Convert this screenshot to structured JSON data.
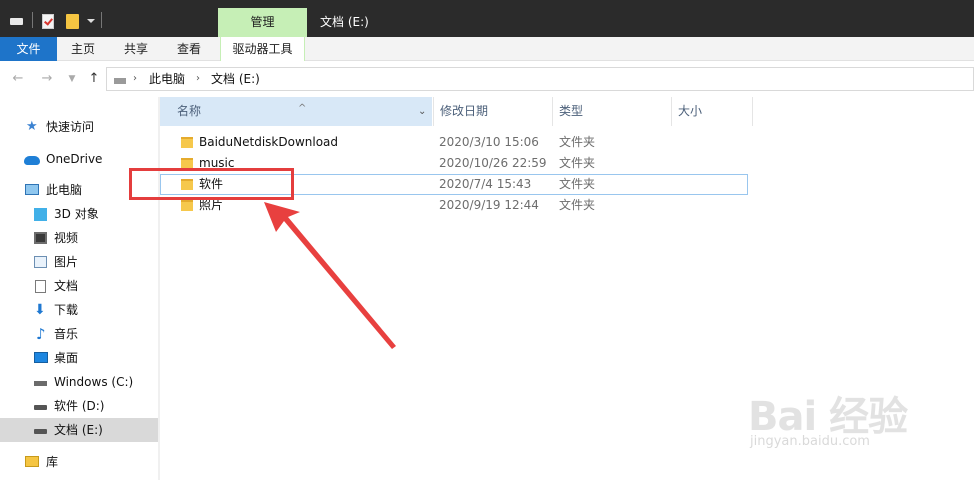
{
  "titlebar": {
    "manage_tab": "管理",
    "window_title": "文档 (E:)"
  },
  "ribbon": {
    "tabs": [
      "文件",
      "主页",
      "共享",
      "查看",
      "驱动器工具"
    ]
  },
  "address": {
    "segments": [
      "此电脑",
      "文档 (E:)"
    ]
  },
  "sidebar": {
    "items": [
      {
        "label": "快速访问",
        "icon": "star-icon"
      },
      {
        "label": "OneDrive",
        "icon": "cloud-icon"
      },
      {
        "label": "此电脑",
        "icon": "computer-icon"
      },
      {
        "label": "3D 对象",
        "icon": "cube-icon"
      },
      {
        "label": "视频",
        "icon": "video-icon"
      },
      {
        "label": "图片",
        "icon": "picture-icon"
      },
      {
        "label": "文档",
        "icon": "document-icon"
      },
      {
        "label": "下载",
        "icon": "download-icon"
      },
      {
        "label": "音乐",
        "icon": "music-icon"
      },
      {
        "label": "桌面",
        "icon": "desktop-icon"
      },
      {
        "label": "Windows (C:)",
        "icon": "windows-drive-icon"
      },
      {
        "label": "软件 (D:)",
        "icon": "drive-icon"
      },
      {
        "label": "文档 (E:)",
        "icon": "drive-icon",
        "selected": true
      },
      {
        "label": "库",
        "icon": "library-icon"
      }
    ]
  },
  "columns": {
    "name": "名称",
    "date": "修改日期",
    "type": "类型",
    "size": "大小"
  },
  "files": [
    {
      "name": "BaiduNetdiskDownload",
      "date": "2020/3/10 15:06",
      "type": "文件夹"
    },
    {
      "name": "music",
      "date": "2020/10/26 22:59",
      "type": "文件夹"
    },
    {
      "name": "软件",
      "date": "2020/7/4 15:43",
      "type": "文件夹",
      "selected": true
    },
    {
      "name": "照片",
      "date": "2020/9/19 12:44",
      "type": "文件夹"
    }
  ],
  "watermark": {
    "main": "Bai  经验",
    "sub": "jingyan.baidu.com"
  },
  "colors": {
    "accent": "#1e74c9",
    "manage_tab": "#c6efb6",
    "annotation": "#e43d3d",
    "folder": "#f6c84c"
  }
}
